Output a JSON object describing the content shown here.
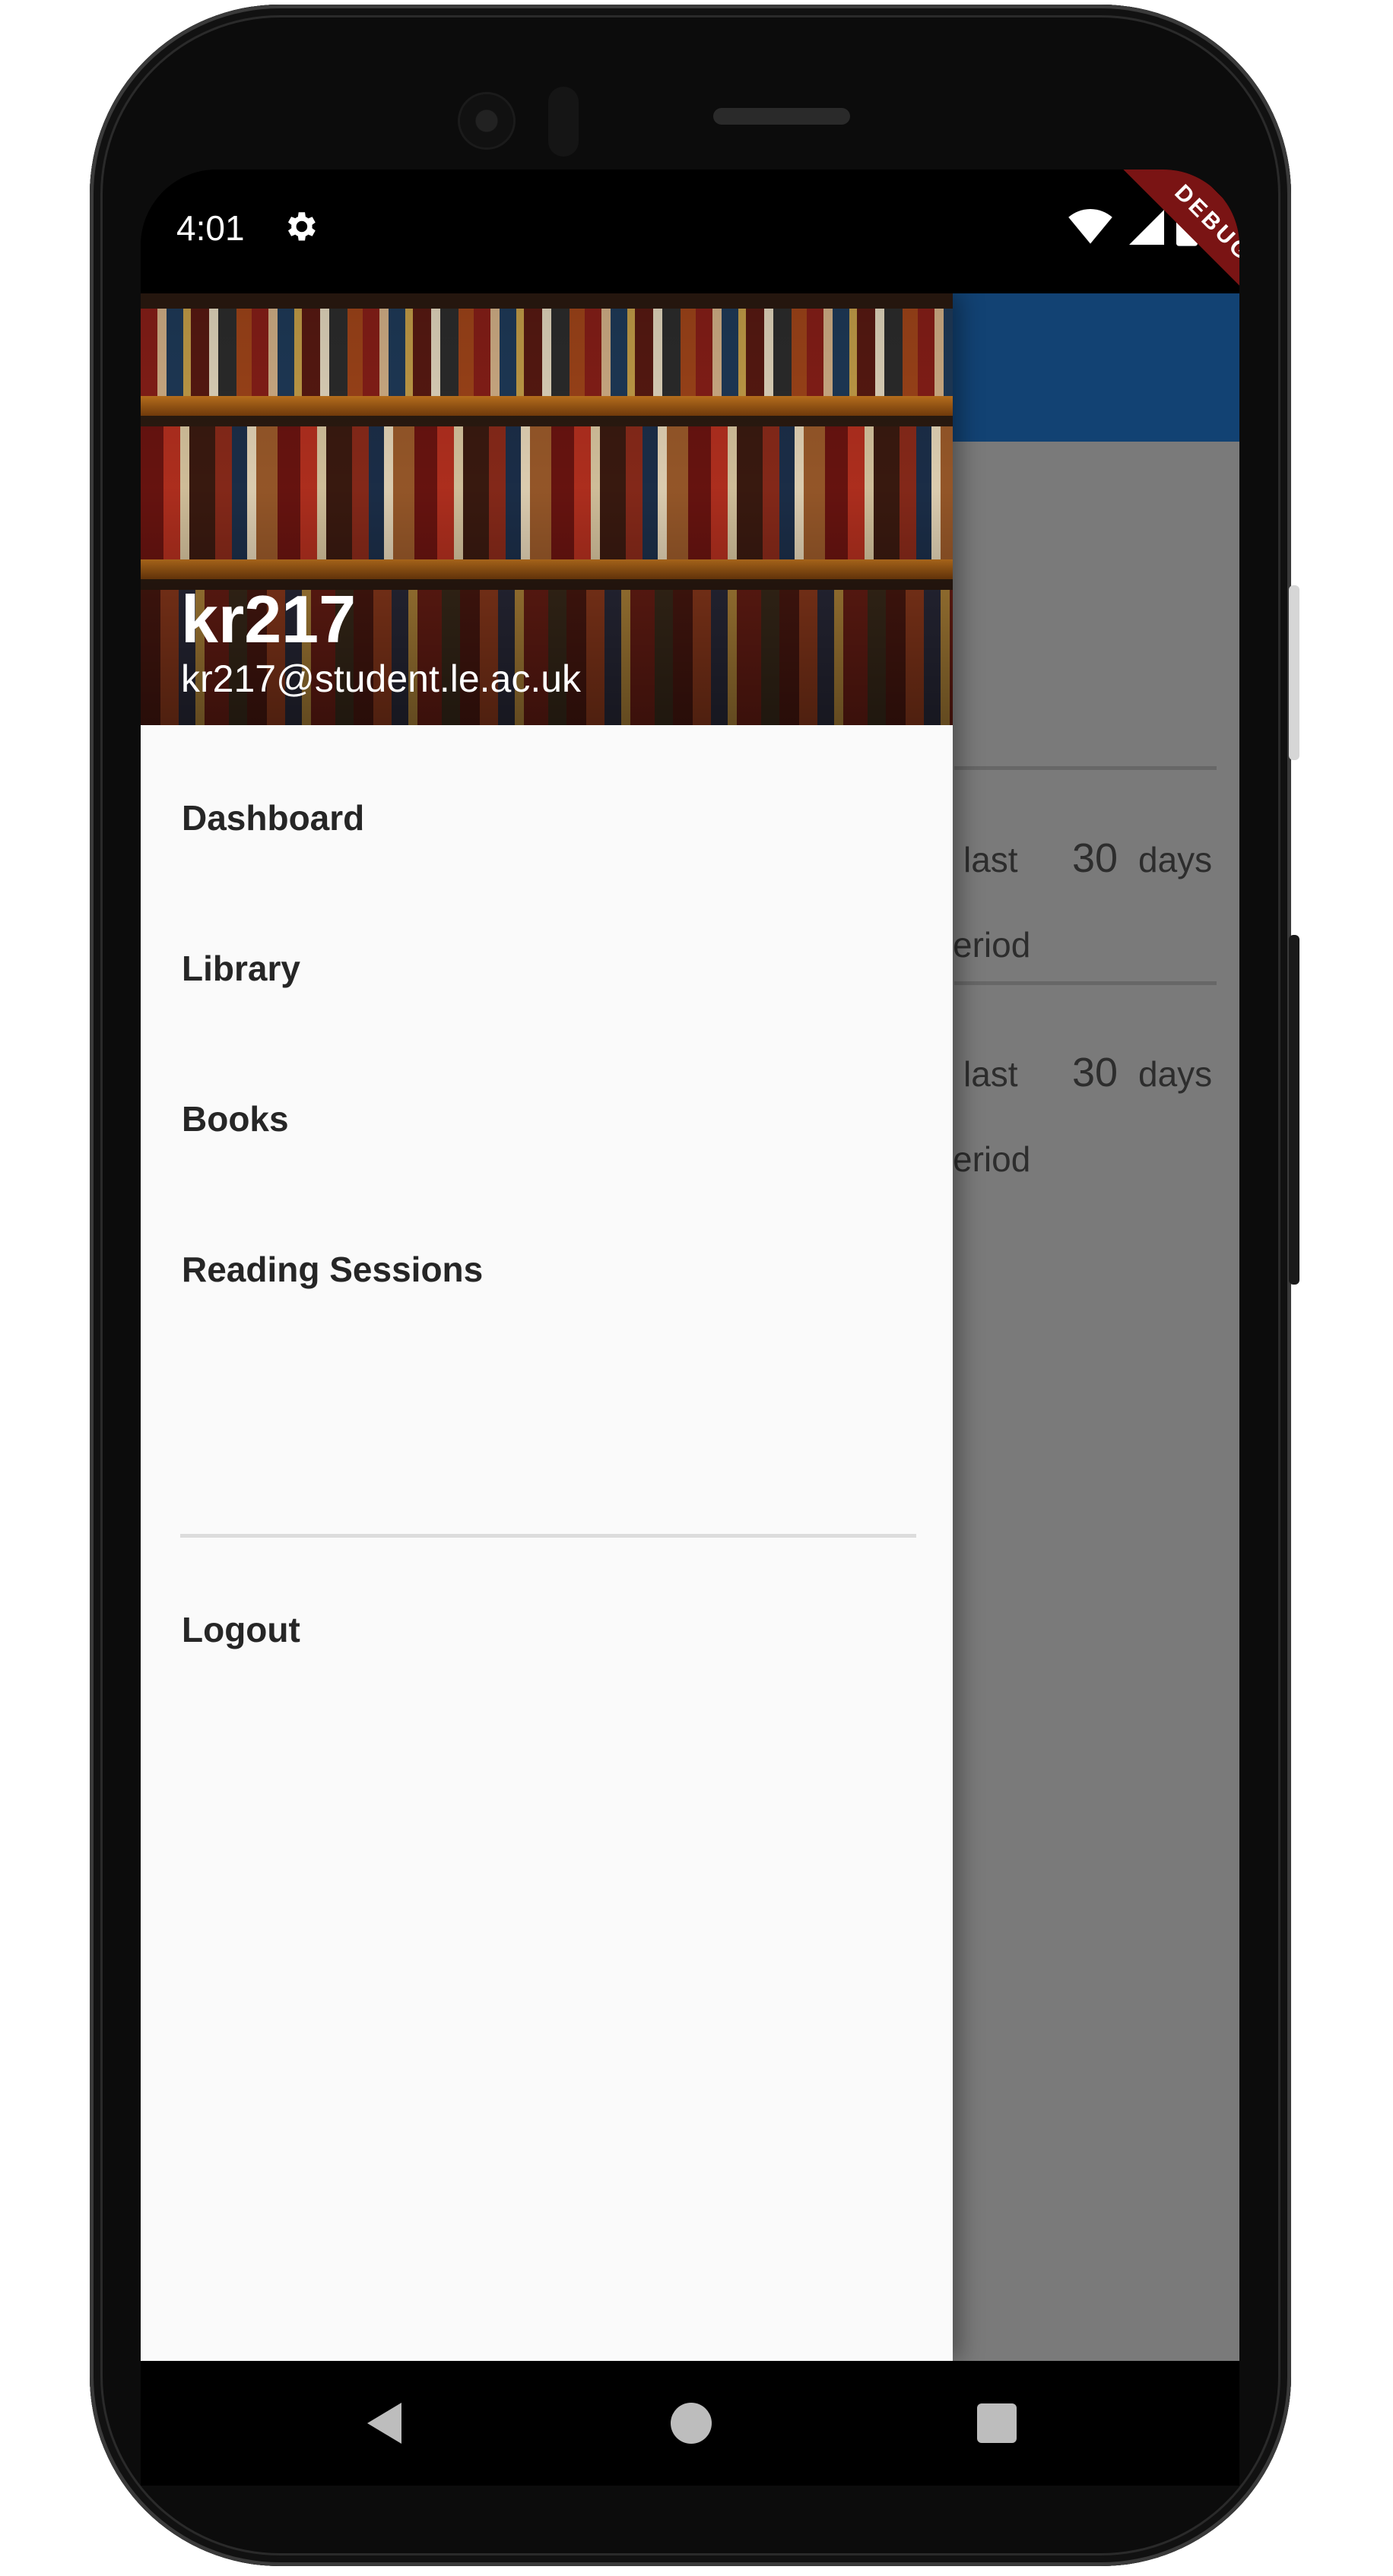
{
  "status_bar": {
    "time": "4:01",
    "debug_label": "DEBUG",
    "icons": [
      "gear-icon",
      "wifi-icon",
      "signal-icon",
      "battery-icon"
    ]
  },
  "background_content": {
    "rows": [
      {
        "prefix": "last",
        "number": "30",
        "suffix": "days",
        "second_line": "eriod"
      },
      {
        "prefix": "last",
        "number": "30",
        "suffix": "days",
        "second_line": "eriod"
      }
    ],
    "appbar_color": "#124273"
  },
  "drawer": {
    "header": {
      "username": "kr217",
      "email": "kr217@student.le.ac.uk",
      "background": "bookshelf-image"
    },
    "menu_items": [
      {
        "label": "Dashboard"
      },
      {
        "label": "Library"
      },
      {
        "label": "Books"
      },
      {
        "label": "Reading Sessions"
      }
    ],
    "logout_label": "Logout"
  },
  "nav_bar": {
    "icons": [
      "back-icon",
      "home-icon",
      "recents-icon"
    ]
  }
}
